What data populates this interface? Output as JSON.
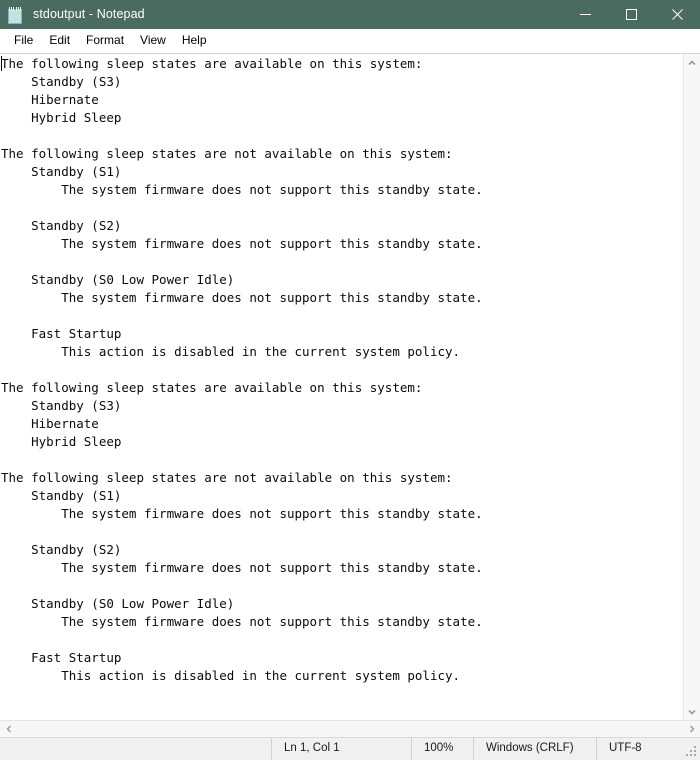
{
  "window": {
    "title": "stdoutput - Notepad",
    "icon": "notepad-icon",
    "titlebar_color": "#4a6b5f",
    "controls": {
      "minimize": "minimize-icon",
      "maximize": "maximize-icon",
      "close": "close-icon"
    }
  },
  "menubar": {
    "items": [
      {
        "label": "File"
      },
      {
        "label": "Edit"
      },
      {
        "label": "Format"
      },
      {
        "label": "View"
      },
      {
        "label": "Help"
      }
    ]
  },
  "editor": {
    "content": "The following sleep states are available on this system:\n    Standby (S3)\n    Hibernate\n    Hybrid Sleep\n\nThe following sleep states are not available on this system:\n    Standby (S1)\n        The system firmware does not support this standby state.\n\n    Standby (S2)\n        The system firmware does not support this standby state.\n\n    Standby (S0 Low Power Idle)\n        The system firmware does not support this standby state.\n\n    Fast Startup\n        This action is disabled in the current system policy.\n\nThe following sleep states are available on this system:\n    Standby (S3)\n    Hibernate\n    Hybrid Sleep\n\nThe following sleep states are not available on this system:\n    Standby (S1)\n        The system firmware does not support this standby state.\n\n    Standby (S2)\n        The system firmware does not support this standby state.\n\n    Standby (S0 Low Power Idle)\n        The system firmware does not support this standby state.\n\n    Fast Startup\n        This action is disabled in the current system policy.\n"
  },
  "scrollbars": {
    "vertical": {
      "up_arrow": "chevron-up-icon",
      "down_arrow": "chevron-down-icon"
    },
    "horizontal": {
      "left_arrow": "chevron-left-icon",
      "right_arrow": "chevron-right-icon"
    }
  },
  "statusbar": {
    "position": "Ln 1, Col 1",
    "zoom": "100%",
    "line_ending": "Windows (CRLF)",
    "encoding": "UTF-8"
  }
}
